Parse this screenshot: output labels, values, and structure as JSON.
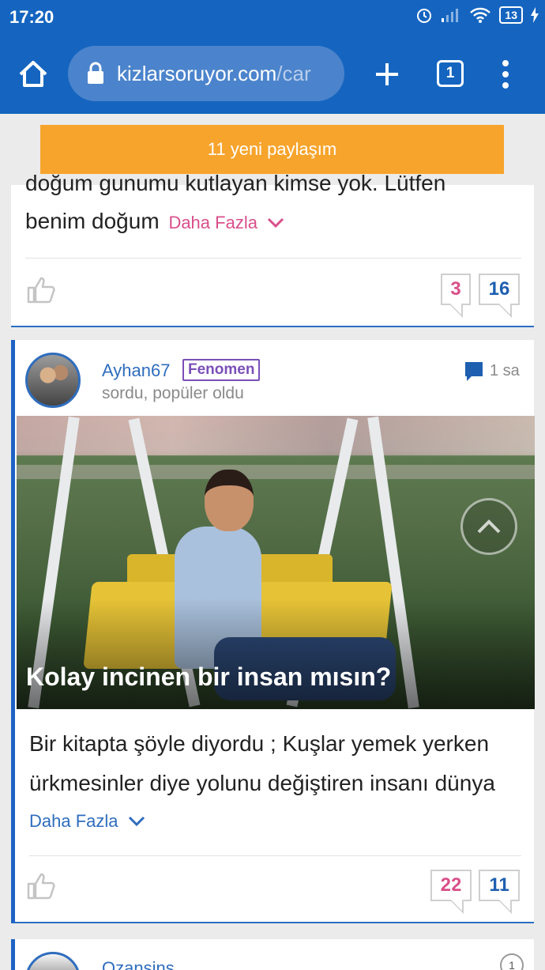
{
  "status_bar": {
    "time": "17:20",
    "battery": "13"
  },
  "browser": {
    "url_host": "kizlarsoruyor.com",
    "url_path": "/car",
    "tab_count": "1"
  },
  "banner": {
    "label": "11 yeni paylaşım"
  },
  "card1": {
    "cut_line": "doğum gunumu kutlayan kimse yok. Lütfen",
    "teaser": "benim doğum",
    "more_label": "Daha Fazla",
    "count_pink": "3",
    "count_blue": "16"
  },
  "card2": {
    "username": "Ayhan67",
    "badge": "Fenomen",
    "subline": "sordu, popüler oldu",
    "time": "1 sa",
    "image_title": "Kolay incinen bir insan mısın?",
    "body": "Bir kitapta şöyle diyordu ; Kuşlar yemek yerken ürkmesinler diye yolunu değiştiren insanı dünya",
    "more_label": "Daha Fazla",
    "count_pink": "22",
    "count_blue": "11"
  },
  "card3": {
    "username": "Ozansins",
    "rank": "1"
  },
  "colors": {
    "primary": "#1565c0",
    "banner": "#f7a42c",
    "pink": "#d94f8a",
    "link": "#2f6dbd",
    "badge": "#7a4fb8"
  },
  "icons": [
    "home-icon",
    "lock-icon",
    "plus-icon",
    "tabs-icon",
    "menu-icon",
    "thumbs-up-icon",
    "comment-icon",
    "chevron-down-icon",
    "chevron-up-icon"
  ]
}
